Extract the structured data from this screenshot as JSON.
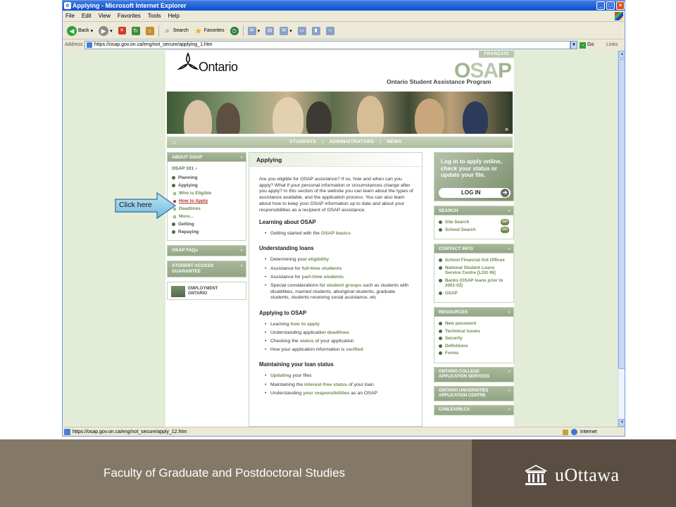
{
  "browser": {
    "title": "Applying - Microsoft Internet Explorer",
    "menu": [
      "File",
      "Edit",
      "View",
      "Favorites",
      "Tools",
      "Help"
    ],
    "toolbar": {
      "back": "Back",
      "search": "Search",
      "favorites": "Favorites"
    },
    "address_label": "Address",
    "url": "https://osap.gov.on.ca/eng/not_secure/applying_1.htm",
    "go": "Go",
    "links": "Links",
    "status_url": "https://osap.gov.on.ca/eng/not_secure/apply_12.htm",
    "zone": "Internet"
  },
  "site": {
    "francais": "FRANÇAIS",
    "ontario": "Ontario",
    "osap_logo_o": "O",
    "osap_logo_sa": "SA",
    "osap_logo_p": "P",
    "osap_subtitle": "Ontario Student Assistance Program",
    "nav": [
      "STUDENTS",
      "ADMINISTRATORS",
      "NEWS"
    ]
  },
  "left": {
    "about": "ABOUT OSAP",
    "osap101": "OSAP 101",
    "items": [
      {
        "label": "Planning"
      },
      {
        "label": "Applying"
      },
      {
        "label": "Who is Eligible",
        "sub": true
      },
      {
        "label": "How to Apply",
        "sub": true,
        "active": true
      },
      {
        "label": "Deadlines",
        "sub": true
      },
      {
        "label": "More...",
        "sub": true
      },
      {
        "label": "Getting"
      },
      {
        "label": "Repaying"
      }
    ],
    "faqs": "OSAP FAQs",
    "guarantee_line1": "STUDENT ACCESS",
    "guarantee_line2": "GUARANTEE",
    "employment_line1": "EMPLOYMENT",
    "employment_line2": "ONTARIO"
  },
  "center": {
    "heading": "Applying",
    "intro": "Are you eligible for OSAP assistance? If so, how and when can you apply? What if your personal information or circumstances change after you apply? In this section of the website you can learn about the types of assistance available, and the application process. You can also learn about how to keep your OSAP information up to date and about your responsibilities as a recipient of OSAP assistance.",
    "sections": [
      {
        "title": "Learning about OSAP",
        "items": [
          {
            "pre": "Getting started with the ",
            "link": "OSAP basics",
            "post": ""
          }
        ]
      },
      {
        "title": "Understanding loans",
        "items": [
          {
            "pre": "Determining your ",
            "link": "eligibility",
            "post": ""
          },
          {
            "pre": "Assistance for ",
            "link": "full-time students",
            "post": ""
          },
          {
            "pre": "Assistance for ",
            "link": "part-time students",
            "post": ""
          },
          {
            "pre": "Special considerations for ",
            "link": "student groups",
            "post": " such as students with disabilities, married students, aboriginal students, graduate students, students receiving social assistance, etc"
          }
        ]
      },
      {
        "title": "Applying to OSAP",
        "items": [
          {
            "pre": "Learning ",
            "link": "how to apply",
            "post": ""
          },
          {
            "pre": "Understanding application ",
            "link": "deadlines",
            "post": ""
          },
          {
            "pre": "Checking the ",
            "link": "status",
            "post": " of your application"
          },
          {
            "pre": "How your application information is ",
            "link": "verified",
            "post": ""
          }
        ]
      },
      {
        "title": "Maintaining your loan status",
        "items": [
          {
            "pre": "",
            "link": "Updating",
            "post": " your files"
          },
          {
            "pre": "Maintaining the ",
            "link": "interest-free status",
            "post": " of your loan"
          },
          {
            "pre": "Understanding ",
            "link": "your responsibilities",
            "post": " as an OSAP"
          }
        ]
      }
    ]
  },
  "right": {
    "login_line1": "Log in to apply online,",
    "login_line2": "check your status or",
    "login_line3": "update your file.",
    "login_btn": "LOG IN",
    "search_head": "SEARCH",
    "search_items": [
      "Site Search",
      "School Search"
    ],
    "go": "GO",
    "contact_head": "CONTACT INFO",
    "contact_items": [
      "School Financial Aid Offices",
      "National Student Loans Service Centre [LOG IN]",
      "Banks (OSAP loans prior to 2001-02)",
      "OSAP"
    ],
    "resources_head": "RESOURCES",
    "resources_items": [
      "New password",
      "Technical issues",
      "Security",
      "Definitions",
      "Forms"
    ],
    "college_line1": "ONTARIO COLLEGE",
    "college_line2": "APPLICATION SERVICES",
    "univ_line1": "ONTARIO UNIVERSITIES",
    "univ_line2": "APPLICATION CENTRE",
    "canlearn": "CANLEARN.CA"
  },
  "callout": {
    "label": "Click here"
  },
  "footer": {
    "faculty": "Faculty of Graduate and Postdoctoral Studies",
    "university": "uOttawa"
  }
}
